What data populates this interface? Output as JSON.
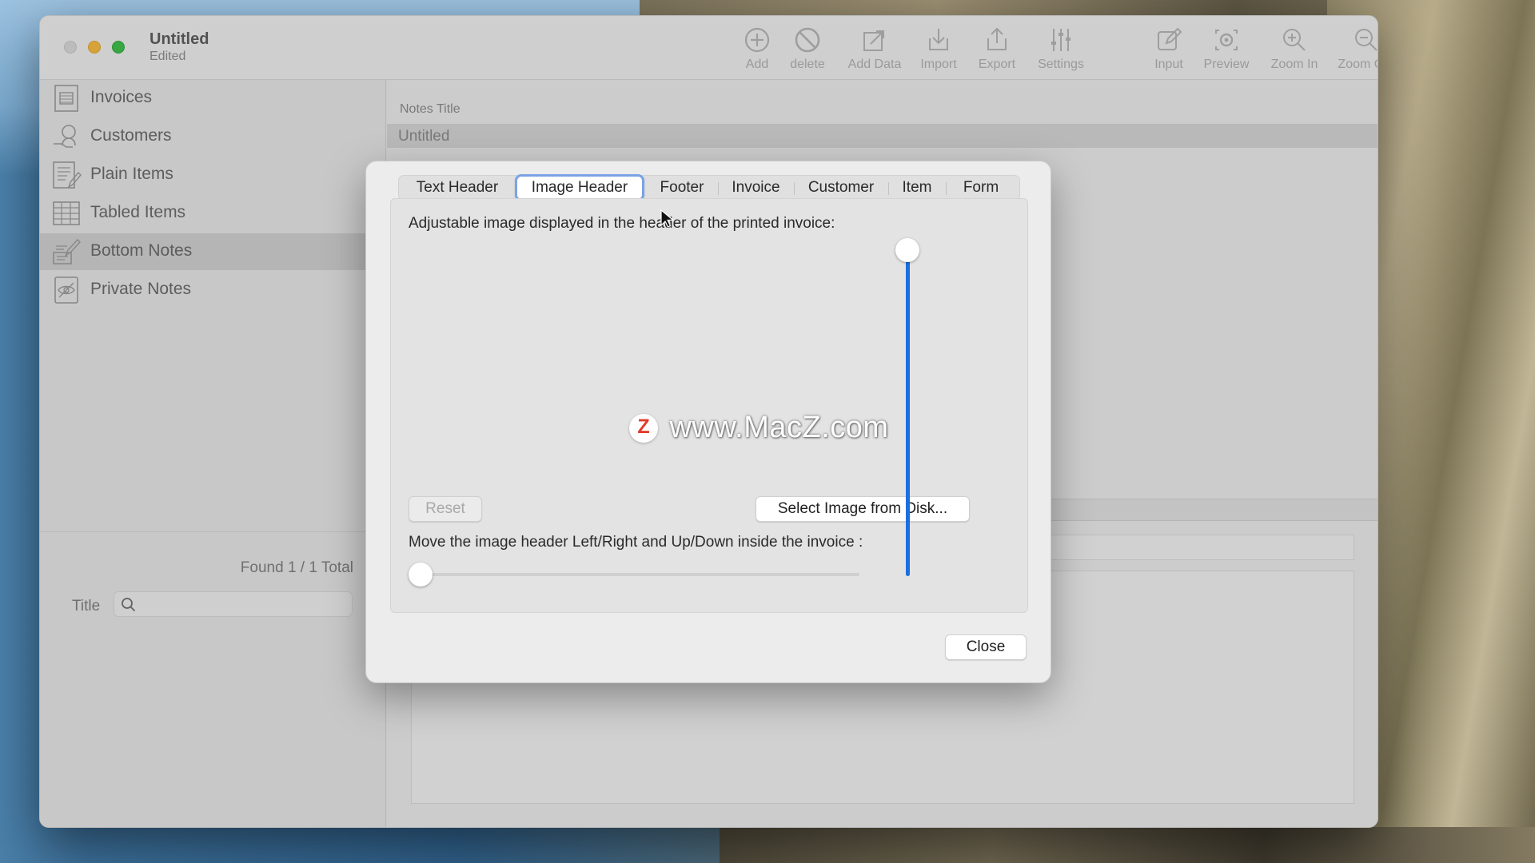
{
  "window": {
    "title": "Untitled",
    "subtitle": "Edited"
  },
  "toolbar": {
    "items": [
      {
        "label": "Add",
        "icon": "plus-circle-icon"
      },
      {
        "label": "delete",
        "icon": "prohibit-icon"
      },
      {
        "label": "Add Data",
        "icon": "add-data-icon"
      },
      {
        "label": "Import",
        "icon": "import-icon"
      },
      {
        "label": "Export",
        "icon": "export-icon"
      },
      {
        "label": "Settings",
        "icon": "sliders-icon"
      },
      {
        "label": "Input",
        "icon": "pencil-square-icon"
      },
      {
        "label": "Preview",
        "icon": "eye-icon"
      },
      {
        "label": "Zoom In",
        "icon": "zoom-in-icon"
      },
      {
        "label": "Zoom Out",
        "icon": "zoom-out-icon"
      }
    ]
  },
  "sidebar": {
    "items": [
      {
        "label": "Invoices",
        "icon": "invoice-icon"
      },
      {
        "label": "Customers",
        "icon": "customer-icon"
      },
      {
        "label": "Plain Items",
        "icon": "plain-items-icon"
      },
      {
        "label": "Tabled Items",
        "icon": "table-icon"
      },
      {
        "label": "Bottom Notes",
        "icon": "notes-icon",
        "selected": true
      },
      {
        "label": "Private Notes",
        "icon": "private-notes-icon"
      }
    ],
    "found": "Found 1 / 1 Total",
    "search_label": "Title",
    "search_value": ""
  },
  "main": {
    "notes_title_label": "Notes Title",
    "notes_title_value": "Untitled"
  },
  "sheet": {
    "tabs": [
      {
        "label": "Text Header"
      },
      {
        "label": "Image Header",
        "active": true
      },
      {
        "label": "Footer"
      },
      {
        "label": "Invoice"
      },
      {
        "label": "Customer"
      },
      {
        "label": "Item"
      },
      {
        "label": "Form"
      }
    ],
    "description": "Adjustable image displayed in the header of the printed invoice:",
    "reset_label": "Reset",
    "select_image_label": "Select Image from Disk...",
    "move_description": "Move the image header Left/Right and Up/Down inside the invoice :",
    "close_label": "Close",
    "horizontal_slider_value": 0,
    "vertical_slider_value": 1
  },
  "watermark": {
    "logo_letter": "Z",
    "text": "www.MacZ.com"
  },
  "colors": {
    "accent": "#1b6fe0",
    "tab_focus": "#7aa3e6"
  }
}
